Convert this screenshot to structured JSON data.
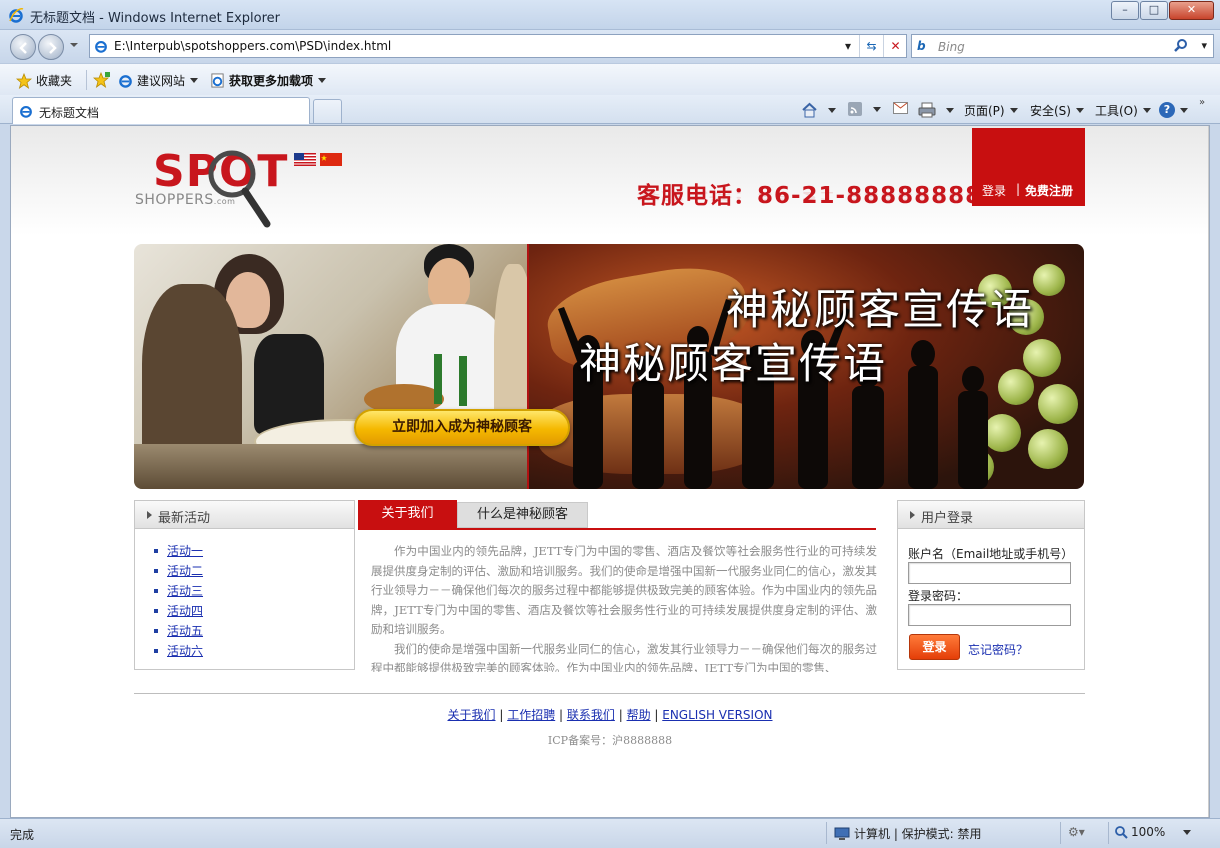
{
  "window": {
    "title": "无标题文档 - Windows Internet Explorer",
    "min": "–",
    "max": "□",
    "close": "✕"
  },
  "nav": {
    "url": "E:\\Interpub\\spotshoppers.com\\PSD\\index.html",
    "search_placeholder": "Bing",
    "search_logo": "b"
  },
  "favorites": {
    "favorites_label": "收藏夹",
    "suggested_sites": "建议网站",
    "get_addons": "获取更多加载项"
  },
  "tab": {
    "label": "无标题文档"
  },
  "commands": {
    "page": "页面(P)",
    "safety": "安全(S)",
    "tools": "工具(O)",
    "help": "?"
  },
  "header": {
    "logo_top": "SPOT",
    "logo_bottom": "SHOPPERS",
    "logo_domain": ".com",
    "hotline": "客服电话：86-21-88888888",
    "login": "登录",
    "separator": "|",
    "register": "免费注册"
  },
  "banner": {
    "slogan_1": "神秘顾客宣传语",
    "slogan_2": "神秘顾客宣传语",
    "join_button": "立即加入成为神秘顾客"
  },
  "activities": {
    "title": "最新活动",
    "items": [
      "活动一",
      "活动二",
      "活动三",
      "活动四",
      "活动五",
      "活动六"
    ]
  },
  "about": {
    "tab_active": "关于我们",
    "tab_inactive": "什么是神秘顾客",
    "para_1": "作为中国业内的领先品牌，JETT专门为中国的零售、酒店及餐饮等社会服务性行业的可持续发展提供度身定制的评估、激励和培训服务。我们的使命是增强中国新一代服务业同仁的信心，激发其行业领导力－－确保他们每次的服务过程中都能够提供极致完美的顾客体验。作为中国业内的领先品牌，JETT专门为中国的零售、酒店及餐饮等社会服务性行业的可持续发展提供度身定制的评估、激励和培训服务。",
    "para_2": "我们的使命是增强中国新一代服务业同仁的信心，激发其行业领导力－－确保他们每次的服务过程中都能够提供极致完美的顾客体验。作为中国业内的领先品牌，JETT专门为中国的零售、"
  },
  "login_panel": {
    "title": "用户登录",
    "account_label": "账户名（Email地址或手机号）",
    "account_value": "",
    "password_label": "登录密码：",
    "password_value": "",
    "login_button": "登录",
    "forgot": "忘记密码？"
  },
  "footer": {
    "links": [
      "关于我们",
      "工作招聘",
      "联系我们",
      "帮助",
      "ENGLISH VERSION"
    ],
    "icp": "ICP备案号：沪8888888"
  },
  "status": {
    "left": "完成",
    "zone": "计算机 | 保护模式: 禁用",
    "zoom": "100%"
  },
  "colors": {
    "brand_red": "#c80f10",
    "link_blue": "#1a2fb0",
    "button_orange": "#e43e08",
    "join_yellow": "#f5b800"
  }
}
